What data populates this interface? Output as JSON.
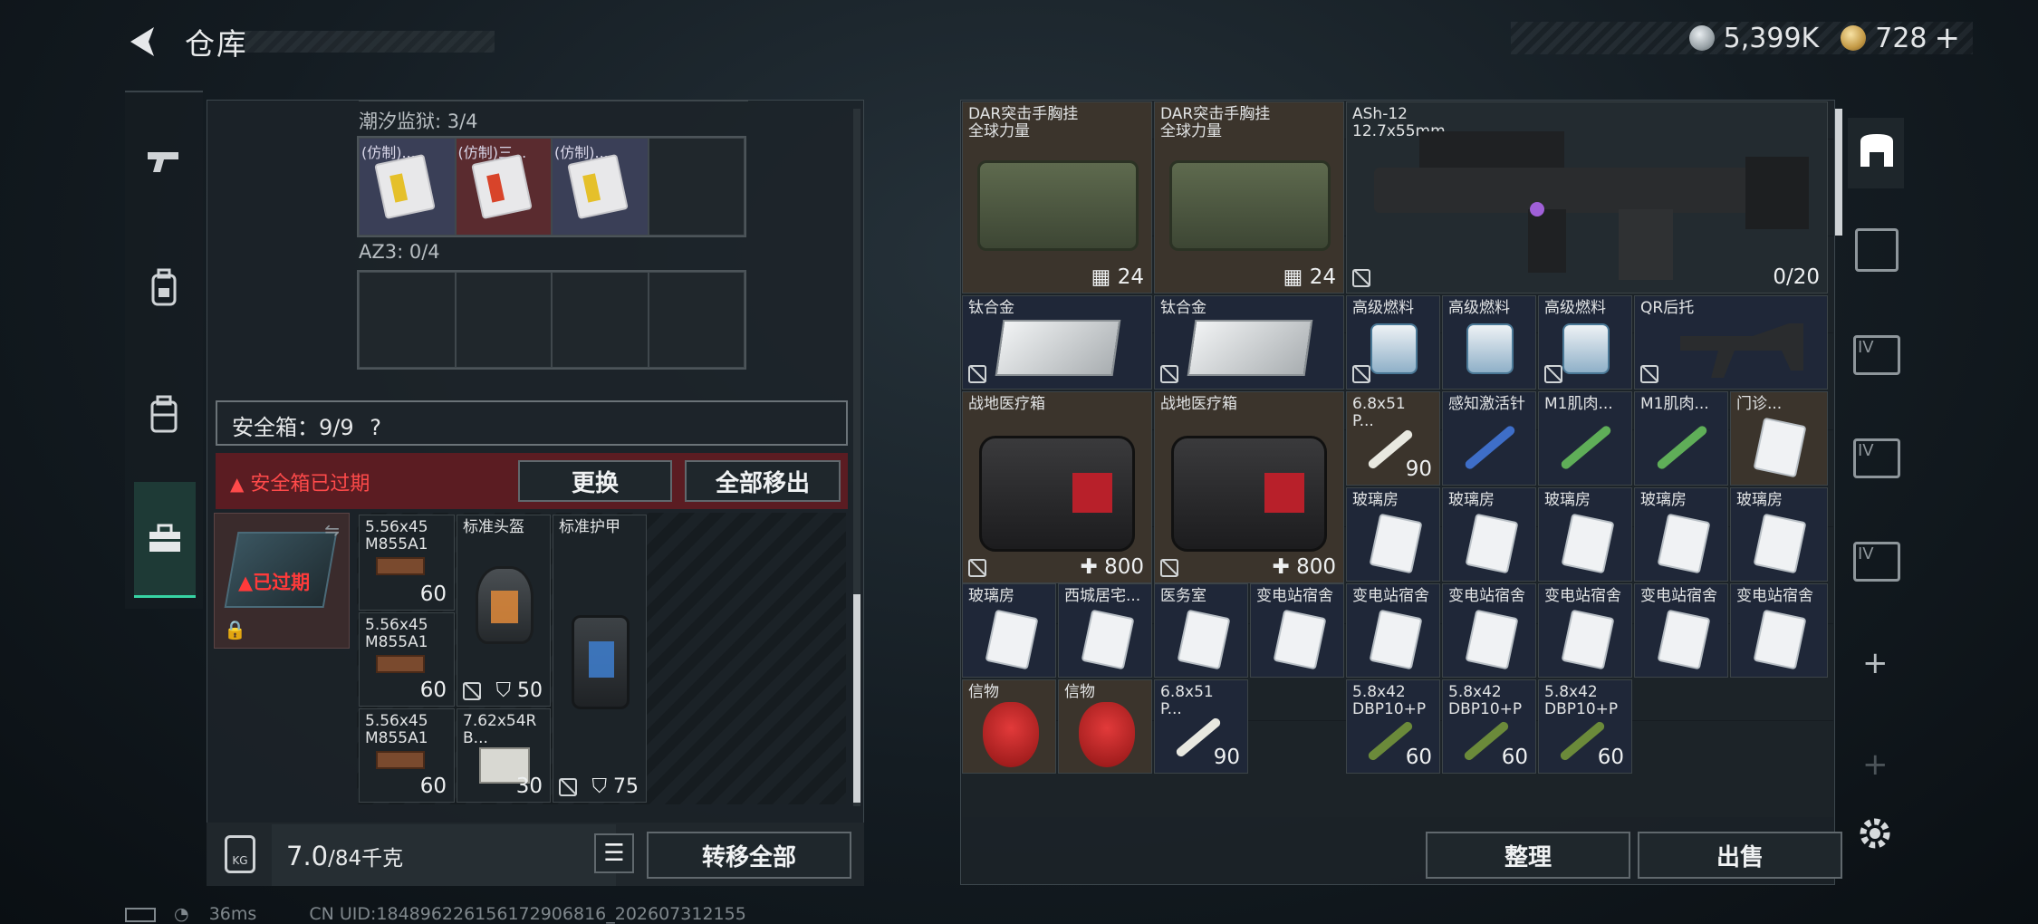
{
  "header": {
    "title": "仓库",
    "silver": "5,399K",
    "gold": "728",
    "gold_add": "+"
  },
  "left": {
    "sec1": "潮汐监狱: 3/4",
    "keycards": [
      "(仿制)...",
      "(仿制)三...",
      "(仿制)..."
    ],
    "sec2": "AZ3: 0/4",
    "safe_label": "安全箱：9/9",
    "safe_help": "?",
    "expired_msg": "安全箱已过期",
    "btn_replace": "更换",
    "btn_move_all_out": "全部移出",
    "case_status": "已过期",
    "items": [
      {
        "name": "5.56x45\nM855A1",
        "val": "60"
      },
      {
        "name": "标准头盔",
        "val": "50"
      },
      {
        "name": "标准护甲",
        "val": "75"
      },
      {
        "name": "5.56x45\nM855A1",
        "val": "60"
      },
      {
        "name": "5.56x45\nM855A1",
        "val": "60"
      },
      {
        "name": "7.62x54R\nB...",
        "val": "30"
      }
    ],
    "weight": "7.0",
    "weight_max": "/84千克",
    "btn_transfer_all": "转移全部",
    "kg": "KG"
  },
  "right": {
    "items": {
      "bag1": {
        "name": "DAR突击手胸挂\n全球力量",
        "val": "24"
      },
      "bag2": {
        "name": "DAR突击手胸挂\n全球力量",
        "val": "24"
      },
      "rifle": {
        "name": "ASh-12\n12.7x55mm",
        "val": "0/20"
      },
      "ti1": {
        "name": "钛合金"
      },
      "ti2": {
        "name": "钛合金"
      },
      "fuel1": {
        "name": "高级燃料"
      },
      "fuel2": {
        "name": "高级燃料"
      },
      "fuel3": {
        "name": "高级燃料"
      },
      "stock": {
        "name": "QR后托"
      },
      "med1": {
        "name": "战地医疗箱",
        "val": "800"
      },
      "med2": {
        "name": "战地医疗箱",
        "val": "800"
      },
      "amm1": {
        "name": "6.8x51\nP...",
        "val": "90"
      },
      "inj1": {
        "name": "感知激活针"
      },
      "inj2": {
        "name": "M1肌肉..."
      },
      "inj3": {
        "name": "M1肌肉..."
      },
      "door": {
        "name": "门诊..."
      },
      "g1": {
        "name": "玻璃房"
      },
      "g2": {
        "name": "玻璃房"
      },
      "g3": {
        "name": "玻璃房"
      },
      "g4": {
        "name": "玻璃房"
      },
      "g5": {
        "name": "玻璃房"
      },
      "g6": {
        "name": "玻璃房"
      },
      "west": {
        "name": "西城居宅..."
      },
      "office": {
        "name": "医务室"
      },
      "sub1": {
        "name": "变电站宿舍"
      },
      "sub2": {
        "name": "变电站宿舍"
      },
      "sub3": {
        "name": "变电站宿舍"
      },
      "sub4": {
        "name": "变电站宿舍"
      },
      "sub5": {
        "name": "变电站宿舍"
      },
      "sub6": {
        "name": "变电站宿舍"
      },
      "token1": {
        "name": "信物"
      },
      "token2": {
        "name": "信物"
      },
      "amm2": {
        "name": "6.8x51\nP...",
        "val": "90"
      },
      "dbp1": {
        "name": "5.8x42\nDBP10+P",
        "val": "60"
      },
      "dbp2": {
        "name": "5.8x42\nDBP10+P",
        "val": "60"
      },
      "dbp3": {
        "name": "5.8x42\nDBP10+P",
        "val": "60"
      }
    },
    "btn_sort": "整理",
    "btn_sell": "出售"
  },
  "rail_right": {
    "add": "+",
    "add2": "+"
  },
  "status": {
    "ping": "36ms",
    "uid": "CN UID:1848962261561729068​16_202607312155"
  }
}
